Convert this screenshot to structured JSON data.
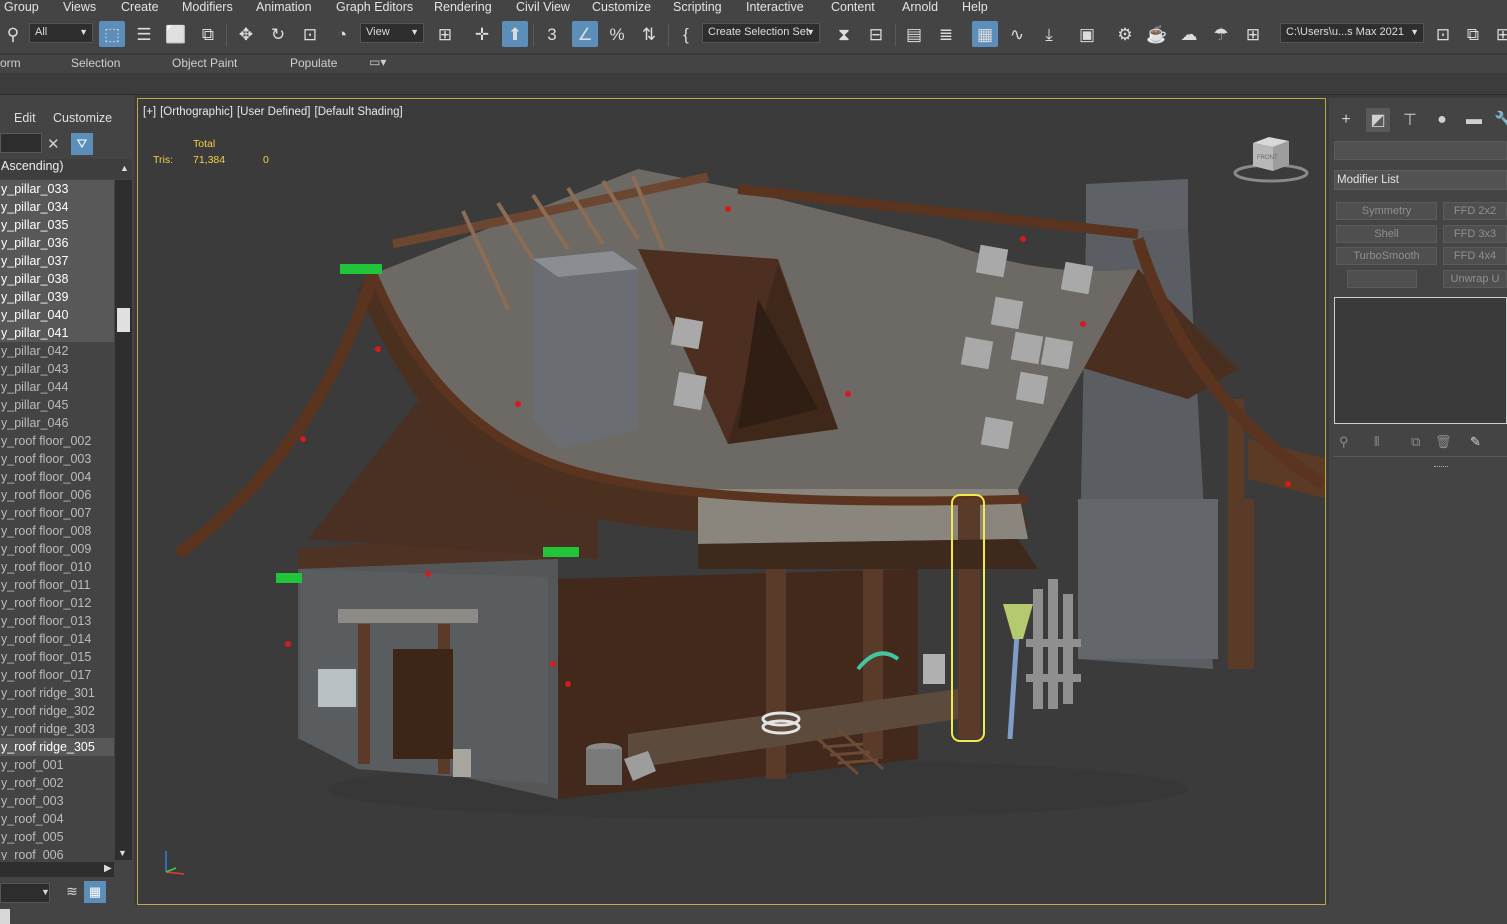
{
  "menu": [
    "Group",
    "Views",
    "Create",
    "Modifiers",
    "Animation",
    "Graph Editors",
    "Rendering",
    "Civil View",
    "Customize",
    "Scripting",
    "Interactive",
    "Content",
    "Arnold",
    "Help"
  ],
  "toolbar": {
    "filter_value": "All",
    "refcoord_value": "View",
    "selection_set_value": "Create Selection Set",
    "project_path": "C:\\Users\\u...s Max 2021"
  },
  "ribbon": {
    "tabs": [
      "orm",
      "Selection",
      "Object Paint",
      "Populate"
    ]
  },
  "explorer": {
    "menu": [
      "Edit",
      "Customize"
    ],
    "sort_header": "Ascending)",
    "items": [
      {
        "label": "y_pillar_033",
        "selected": true
      },
      {
        "label": "y_pillar_034",
        "selected": true
      },
      {
        "label": "y_pillar_035",
        "selected": true
      },
      {
        "label": "y_pillar_036",
        "selected": true
      },
      {
        "label": "y_pillar_037",
        "selected": true
      },
      {
        "label": "y_pillar_038",
        "selected": true
      },
      {
        "label": "y_pillar_039",
        "selected": true
      },
      {
        "label": "y_pillar_040",
        "selected": true
      },
      {
        "label": "y_pillar_041",
        "selected": true
      },
      {
        "label": "y_pillar_042",
        "selected": false
      },
      {
        "label": "y_pillar_043",
        "selected": false
      },
      {
        "label": "y_pillar_044",
        "selected": false
      },
      {
        "label": "y_pillar_045",
        "selected": false
      },
      {
        "label": "y_pillar_046",
        "selected": false
      },
      {
        "label": "y_roof floor_002",
        "selected": false
      },
      {
        "label": "y_roof floor_003",
        "selected": false
      },
      {
        "label": "y_roof floor_004",
        "selected": false
      },
      {
        "label": "y_roof floor_006",
        "selected": false
      },
      {
        "label": "y_roof floor_007",
        "selected": false
      },
      {
        "label": "y_roof floor_008",
        "selected": false
      },
      {
        "label": "y_roof floor_009",
        "selected": false
      },
      {
        "label": "y_roof floor_010",
        "selected": false
      },
      {
        "label": "y_roof floor_011",
        "selected": false
      },
      {
        "label": "y_roof floor_012",
        "selected": false
      },
      {
        "label": "y_roof floor_013",
        "selected": false
      },
      {
        "label": "y_roof floor_014",
        "selected": false
      },
      {
        "label": "y_roof floor_015",
        "selected": false
      },
      {
        "label": "y_roof floor_017",
        "selected": false
      },
      {
        "label": "y_roof ridge_301",
        "selected": false
      },
      {
        "label": "y_roof ridge_302",
        "selected": false
      },
      {
        "label": "y_roof ridge_303",
        "selected": false
      },
      {
        "label": "y_roof ridge_305",
        "selected": true
      },
      {
        "label": "y_roof_001",
        "selected": false
      },
      {
        "label": "y_roof_002",
        "selected": false
      },
      {
        "label": "y_roof_003",
        "selected": false
      },
      {
        "label": "y_roof_004",
        "selected": false
      },
      {
        "label": "y_roof_005",
        "selected": false
      },
      {
        "label": "y_roof_006",
        "selected": false
      }
    ]
  },
  "viewport": {
    "label_plus": "[+]",
    "label_view": "[Orthographic]",
    "label_user": "[User Defined]",
    "label_shading": "[Default Shading]",
    "stats_total": "Total",
    "stats_tris_label": "Tris:",
    "stats_tris_total": "71,384",
    "stats_tris_selected": "0",
    "viewcube_text": "FRONT"
  },
  "command_panel": {
    "modifier_list_label": "Modifier List",
    "modifier_buttons": [
      "Symmetry",
      "FFD 2x2",
      "Shell",
      "FFD 3x3",
      "TurboSmooth",
      "FFD 4x4",
      "",
      "Unwrap U"
    ]
  },
  "colors": {
    "accent_blue": "#5b8fb9",
    "viewport_border": "#bfa84a",
    "stats_yellow": "#f2d04c",
    "selection_highlight": "#f4e94a"
  }
}
